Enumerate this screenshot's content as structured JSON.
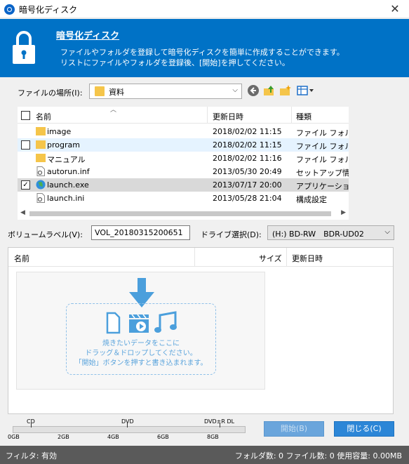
{
  "window": {
    "title": "暗号化ディスク",
    "close_glyph": "✕"
  },
  "banner": {
    "heading": "暗号化ディスク",
    "desc_line1": "ファイルやフォルダを登録して暗号化ディスクを簡単に作成することができます。",
    "desc_line2": "リストにファイルやフォルダを登録後、[開始]を押してください。"
  },
  "location": {
    "label": "ファイルの場所(I):",
    "value": "資料"
  },
  "file_list": {
    "columns": {
      "name": "名前",
      "date": "更新日時",
      "type": "種類"
    },
    "rows": [
      {
        "name": "image",
        "date": "2018/02/02 11:15",
        "type": "ファイル フォルダー",
        "icon": "folder-icon",
        "checked": false
      },
      {
        "name": "program",
        "date": "2018/02/02 11:15",
        "type": "ファイル フォルダー",
        "icon": "folder-icon",
        "checked": false
      },
      {
        "name": "マニュアル",
        "date": "2018/02/02 11:16",
        "type": "ファイル フォルダー",
        "icon": "folder-icon",
        "checked": false
      },
      {
        "name": "autorun.inf",
        "date": "2013/05/30 20:49",
        "type": "セットアップ情報",
        "icon": "settings-file-icon",
        "checked": false
      },
      {
        "name": "launch.exe",
        "date": "2013/07/17 20:00",
        "type": "アプリケーション",
        "icon": "globe-icon",
        "checked": true
      },
      {
        "name": "launch.ini",
        "date": "2013/05/28 21:04",
        "type": "構成設定",
        "icon": "settings-file-icon",
        "checked": false
      }
    ]
  },
  "volume": {
    "label": "ボリュームラベル(V):",
    "value": "VOL_20180315200651"
  },
  "drive": {
    "label": "ドライブ選択(D):",
    "value": "(H:) BD-RW　BDR-UD02"
  },
  "disc_list": {
    "columns": {
      "name": "名前",
      "size": "サイズ",
      "date": "更新日時"
    },
    "drop_text_1": "焼きたいデータをここに",
    "drop_text_2": "ドラッグ＆ドロップしてください。",
    "drop_text_3": "「開始」ボタンを押すと書き込まれます。"
  },
  "capacity": {
    "markers": {
      "cd": "CD",
      "dvd": "DVD",
      "dvd_dl": "DVD±R DL"
    },
    "ticks": [
      "0GB",
      "2GB",
      "4GB",
      "6GB",
      "8GB"
    ],
    "used_fraction": 0
  },
  "buttons": {
    "start": "開始(B)",
    "close": "閉じる(C)"
  },
  "status": {
    "filter": "フィルタ: 有効",
    "counts": "フォルダ数: 0 ファイル数: 0 使用容量: 0.00MB"
  },
  "colors": {
    "brand": "#0072c6",
    "status_bar": "#5a5a5a",
    "selected_row": "#d9d9d9",
    "hover_row": "#e5f3ff"
  }
}
